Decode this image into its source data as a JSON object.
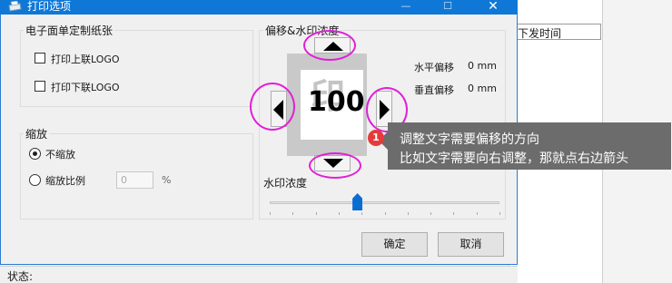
{
  "background": {
    "column_header": "下发时间",
    "status_label": "状态:"
  },
  "dialog": {
    "title": "打印选项",
    "paper_group": {
      "title": "电子面单定制纸张",
      "print_top_logo": "打印上联LOGO",
      "print_bottom_logo": "打印下联LOGO"
    },
    "scale_group": {
      "title": "缩放",
      "no_scale": "不缩放",
      "scale_ratio": "缩放比例",
      "scale_value": "0",
      "scale_unit": "%"
    },
    "offset_group": {
      "title": "偏移&水印浓度",
      "watermark_stamp": "印",
      "watermark_number": "100",
      "h_offset_label": "水平偏移",
      "h_offset_value": "0 mm",
      "v_offset_label": "垂直偏移",
      "v_offset_value": "0 mm",
      "density_label": "水印浓度",
      "density_value": 0.38
    },
    "ok_label": "确定",
    "cancel_label": "取消"
  },
  "tooltip": {
    "badge": "1",
    "line1": "调整文字需要偏移的方向",
    "line2": "比如文字需要向右调整，那就点右边箭头"
  },
  "colors": {
    "title_bar": "#0f78d7",
    "annotation": "#e020d6",
    "tooltip_bg": "#6c6c6c",
    "badge": "#e53b3b",
    "slider": "#0a6dd1"
  }
}
